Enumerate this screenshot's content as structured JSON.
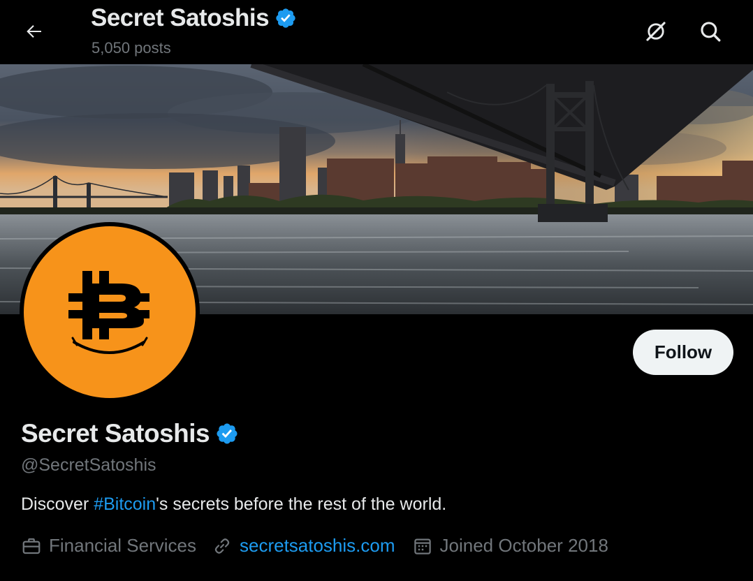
{
  "header": {
    "title": "Secret Satoshis",
    "posts_count": "5,050 posts"
  },
  "profile": {
    "name": "Secret Satoshis",
    "handle": "@SecretSatoshis",
    "bio_prefix": "Discover ",
    "bio_hashtag": "#Bitcoin",
    "bio_suffix": "'s secrets before the rest of the world.",
    "category": "Financial Services",
    "website": "secretsatoshis.com",
    "joined": "Joined October 2018",
    "verified": true
  },
  "actions": {
    "follow_label": "Follow"
  },
  "icons": {
    "back": "arrow-left-icon",
    "topbar_right": [
      "grok-icon",
      "search-icon"
    ],
    "meta": [
      "briefcase-icon",
      "link-icon",
      "calendar-icon"
    ]
  },
  "colors": {
    "background": "#000000",
    "text": "#e7e9ea",
    "secondary_text": "#71767b",
    "accent": "#1d9bf0",
    "avatar": "#f7931a",
    "follow_button": "#eff3f4"
  }
}
